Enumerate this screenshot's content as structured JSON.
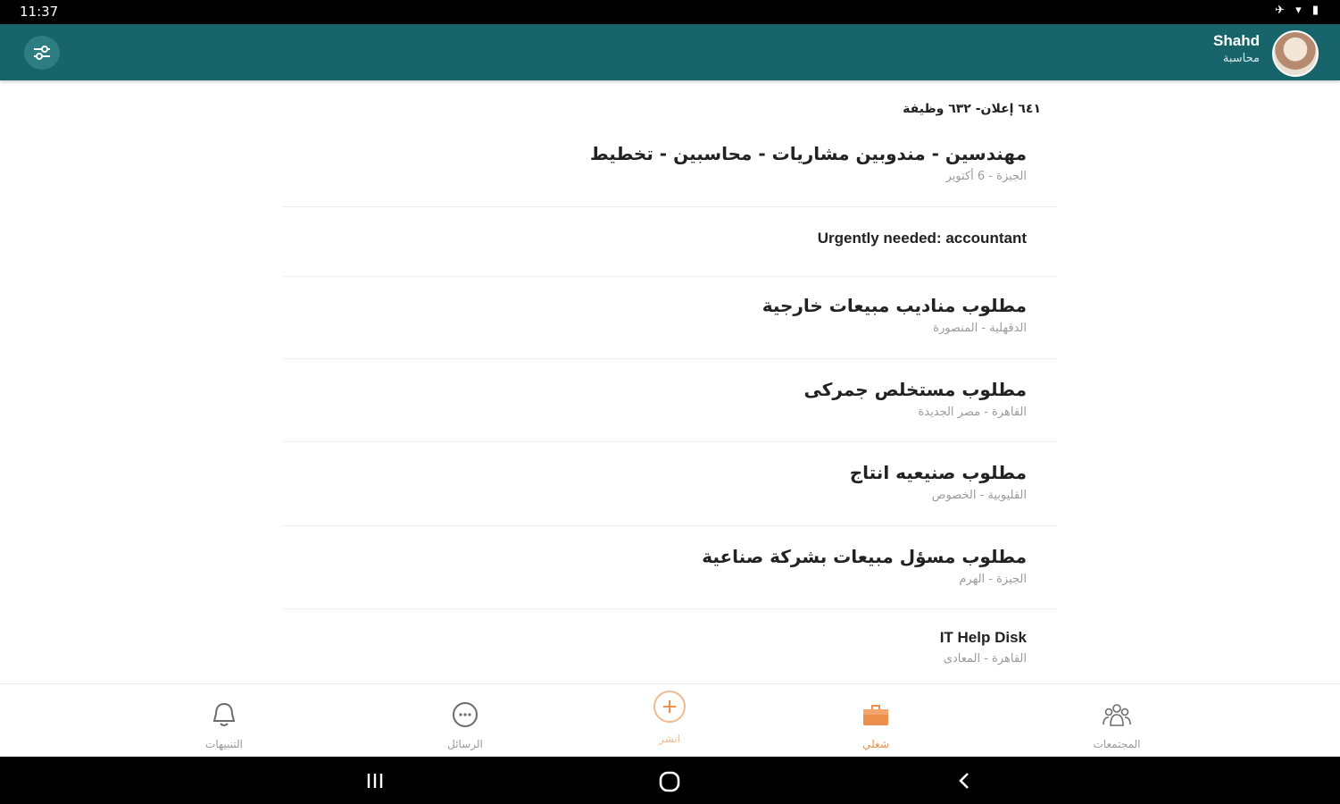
{
  "status_bar": {
    "time": "11:37",
    "system_icons": "✈ ▾ ▮"
  },
  "app_bar": {
    "user_name": "Shahd",
    "user_role": "محاسبة",
    "filter_icon": "sliders-icon",
    "accent": "#17646a"
  },
  "summary": {
    "text": "٦٤١ إعلان- ٦٣٢ وظيفة"
  },
  "jobs": [
    {
      "title": "مهندسين - مندوبين مشاريات - محاسبين - تخطيط",
      "location": "الجيزة - 6 أكتوبر"
    },
    {
      "title": "Urgently needed: accountant",
      "location": ""
    },
    {
      "title": "مطلوب مناديب مبيعات خارجية",
      "location": "الدقهلية - المنصورة"
    },
    {
      "title": "مطلوب مستخلص جمركى",
      "location": "القاهرة - مصر الجديدة"
    },
    {
      "title": "مطلوب صنيعيه انتاج",
      "location": "القليوبية - الخصوص"
    },
    {
      "title": "مطلوب مسؤل مبيعات بشركة صناعية",
      "location": "الجيزة - الهرم"
    },
    {
      "title": "IT Help Disk",
      "location": "القاهرة - المعادى"
    }
  ],
  "bottom_nav": {
    "items": [
      {
        "label": "التنبيهات",
        "icon": "bell-icon"
      },
      {
        "label": "الرسائل",
        "icon": "chat-icon"
      },
      {
        "label": "انشر",
        "icon": "plus-circle-icon"
      },
      {
        "label": "شغلي",
        "icon": "briefcase-icon"
      },
      {
        "label": "المجتمعات",
        "icon": "community-icon"
      }
    ],
    "active_color": "#ec8f4b",
    "inactive_color": "#9a9a9a"
  },
  "system_nav": {
    "icons": [
      "recents-icon",
      "home-icon",
      "back-icon"
    ]
  }
}
